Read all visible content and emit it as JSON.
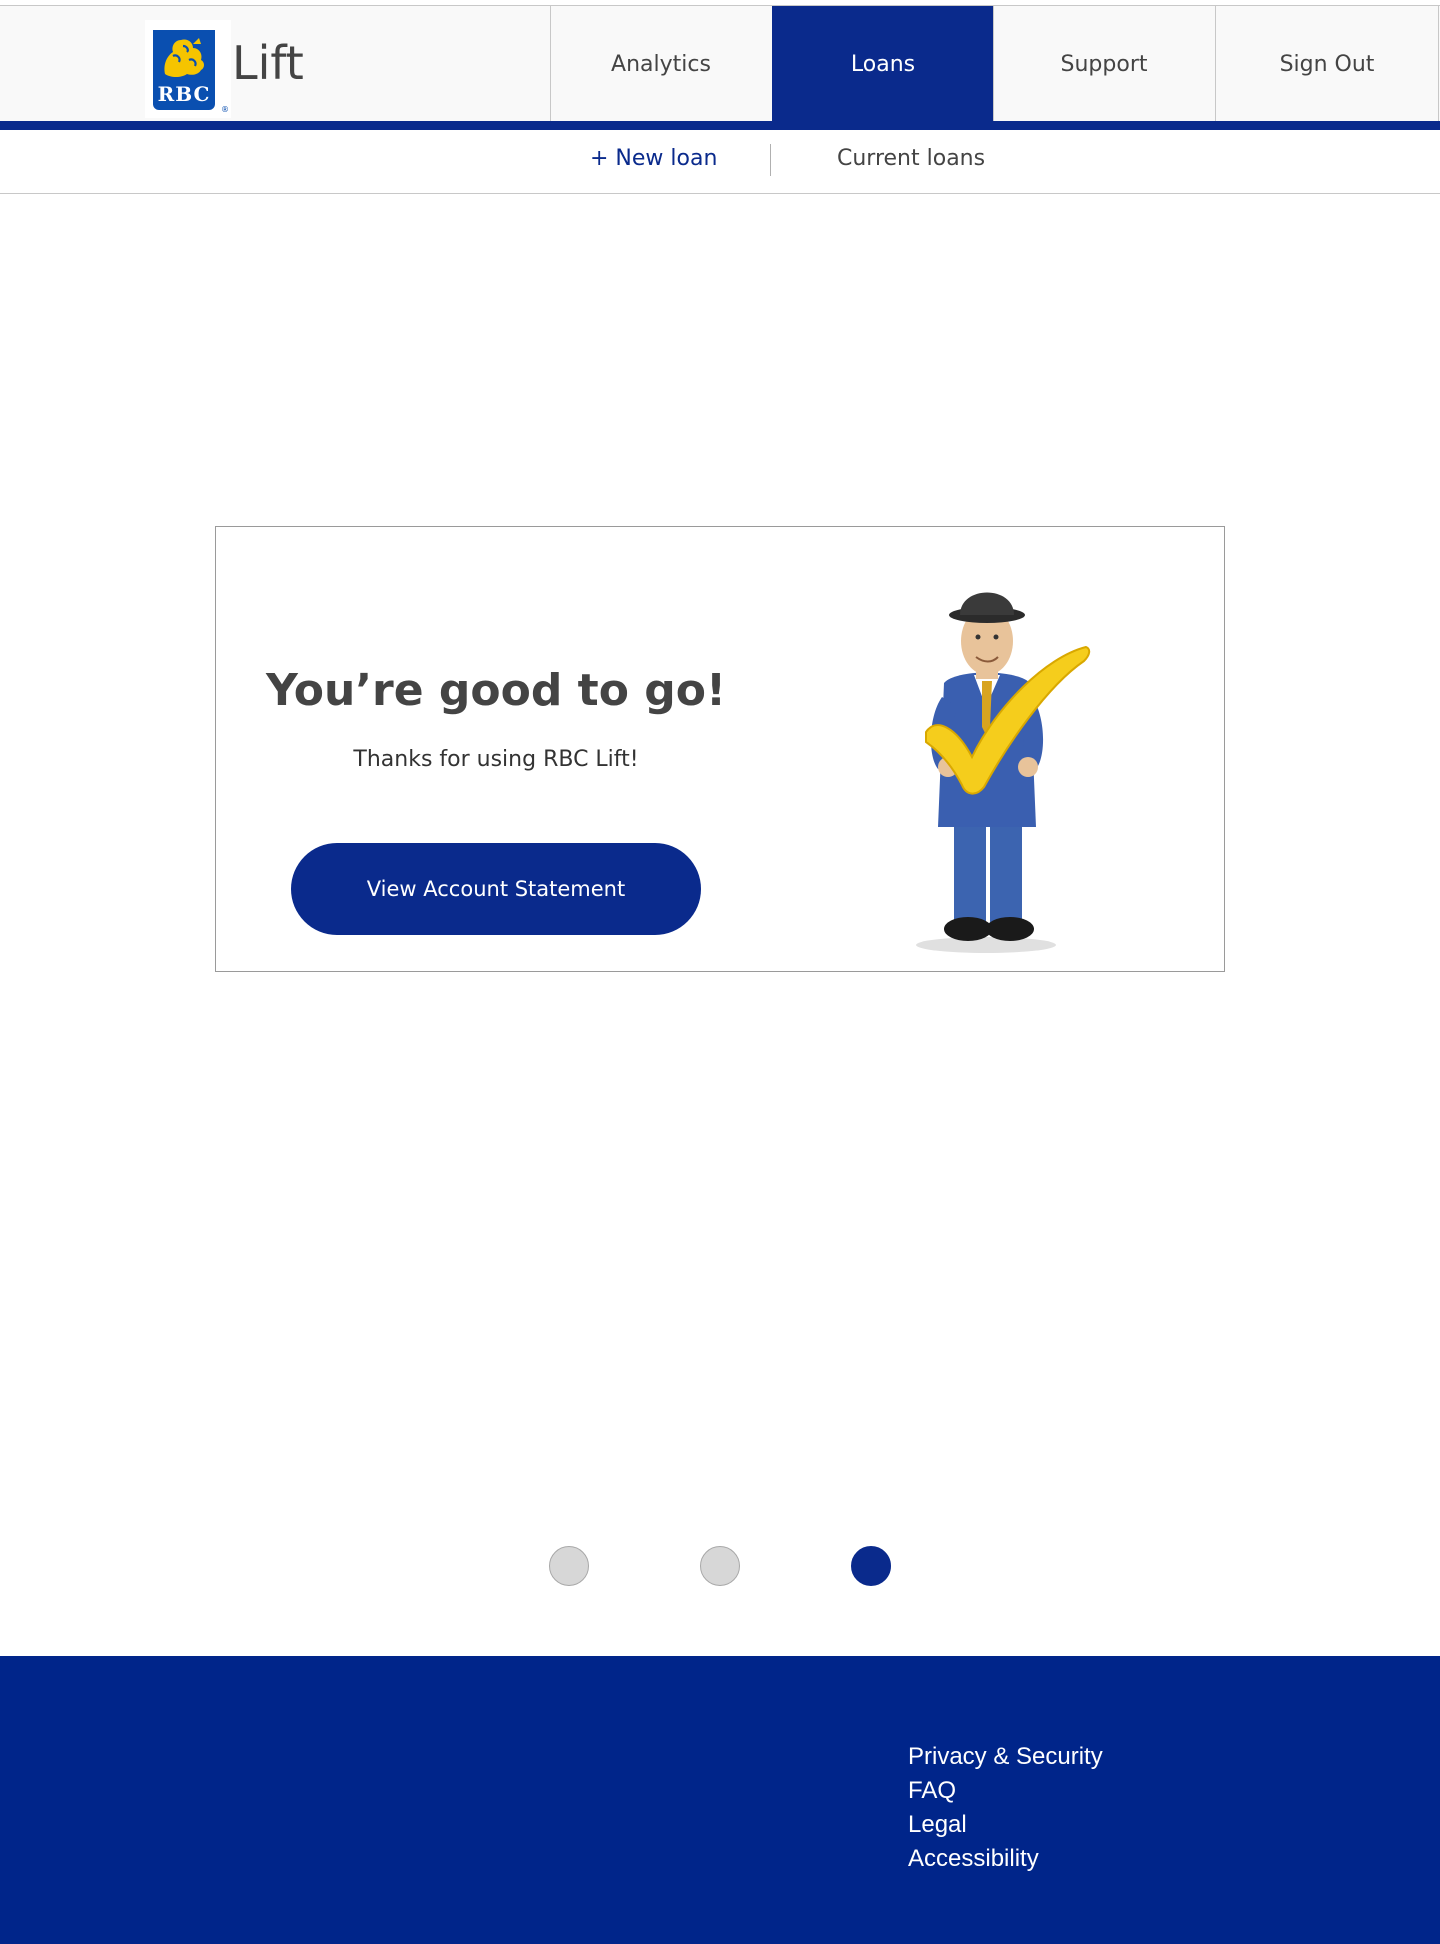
{
  "header": {
    "logo_text": "RBC",
    "app_name": "Lift",
    "nav": [
      {
        "label": "Analytics",
        "active": false
      },
      {
        "label": "Loans",
        "active": true
      },
      {
        "label": "Support",
        "active": false
      },
      {
        "label": "Sign Out",
        "active": false
      }
    ]
  },
  "subnav": {
    "new_loan": "+ New loan",
    "current_loans": "Current loans"
  },
  "card": {
    "title": "You’re good to go!",
    "subtitle": "Thanks for using RBC Lift!",
    "button_label": "View Account Statement"
  },
  "pagination": {
    "total": 3,
    "current": 3
  },
  "footer": {
    "links": [
      "Privacy & Security",
      "FAQ",
      "Legal",
      "Accessibility"
    ]
  },
  "colors": {
    "brand_blue": "#0a2a8c",
    "footer_blue": "#00258a",
    "logo_yellow": "#f5c400"
  }
}
